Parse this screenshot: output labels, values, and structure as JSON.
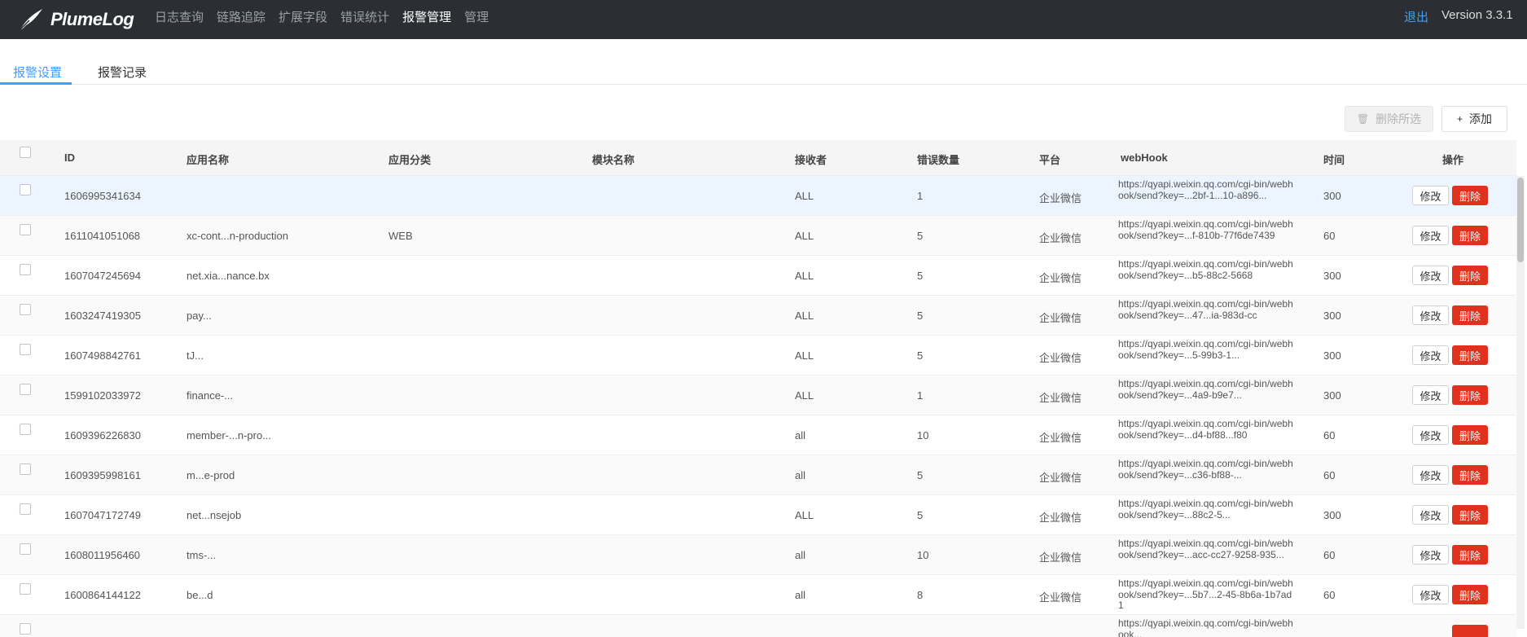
{
  "brand": {
    "name": "PlumeLog"
  },
  "nav": [
    {
      "label": "日志查询",
      "active": false
    },
    {
      "label": "链路追踪",
      "active": false
    },
    {
      "label": "扩展字段",
      "active": false
    },
    {
      "label": "错误统计",
      "active": false
    },
    {
      "label": "报警管理",
      "active": true
    },
    {
      "label": "管理",
      "active": false
    }
  ],
  "header": {
    "logout": "退出",
    "version": "Version 3.3.1"
  },
  "tabs": [
    {
      "label": "报警设置",
      "active": true
    },
    {
      "label": "报警记录",
      "active": false
    }
  ],
  "toolbar": {
    "delete_selected": "删除所选",
    "add": "添加"
  },
  "table": {
    "columns": [
      "ID",
      "应用名称",
      "应用分类",
      "模块名称",
      "接收者",
      "错误数量",
      "平台",
      "webHook",
      "时间",
      "操作"
    ],
    "actions": {
      "edit": "修改",
      "delete": "删除"
    },
    "rows": [
      {
        "id": "1606995341634",
        "app": "",
        "category": "",
        "module": "",
        "receiver": "ALL",
        "errors": "1",
        "platform": "企业微信",
        "webhook": "https://qyapi.weixin.qq.com/cgi-bin/webhook/send?key=...2bf-1...10-a896...",
        "time": "300"
      },
      {
        "id": "1611041051068",
        "app": "xc-cont...n-production",
        "category": "WEB",
        "module": "",
        "receiver": "ALL",
        "errors": "5",
        "platform": "企业微信",
        "webhook": "https://qyapi.weixin.qq.com/cgi-bin/webhook/send?key=...f-810b-77f6de7439",
        "time": "60"
      },
      {
        "id": "1607047245694",
        "app": "net.xia...nance.bx",
        "category": "",
        "module": "",
        "receiver": "ALL",
        "errors": "5",
        "platform": "企业微信",
        "webhook": "https://qyapi.weixin.qq.com/cgi-bin/webhook/send?key=...b5-88c2-5668",
        "time": "300"
      },
      {
        "id": "1603247419305",
        "app": "pay...",
        "category": "",
        "module": "",
        "receiver": "ALL",
        "errors": "5",
        "platform": "企业微信",
        "webhook": "https://qyapi.weixin.qq.com/cgi-bin/webhook/send?key=...47...ia-983d-cc",
        "time": "300"
      },
      {
        "id": "1607498842761",
        "app": "tJ...",
        "category": "",
        "module": "",
        "receiver": "ALL",
        "errors": "5",
        "platform": "企业微信",
        "webhook": "https://qyapi.weixin.qq.com/cgi-bin/webhook/send?key=...5-99b3-1...",
        "time": "300"
      },
      {
        "id": "1599102033972",
        "app": "finance-...",
        "category": "",
        "module": "",
        "receiver": "ALL",
        "errors": "1",
        "platform": "企业微信",
        "webhook": "https://qyapi.weixin.qq.com/cgi-bin/webhook/send?key=...4a9-b9e7...",
        "time": "300"
      },
      {
        "id": "1609396226830",
        "app": "member-...n-pro...",
        "category": "",
        "module": "",
        "receiver": "all",
        "errors": "10",
        "platform": "企业微信",
        "webhook": "https://qyapi.weixin.qq.com/cgi-bin/webhook/send?key=...d4-bf88...f80",
        "time": "60"
      },
      {
        "id": "1609395998161",
        "app": "m...e-prod",
        "category": "",
        "module": "",
        "receiver": "all",
        "errors": "5",
        "platform": "企业微信",
        "webhook": "https://qyapi.weixin.qq.com/cgi-bin/webhook/send?key=...c36-bf88-...",
        "time": "60"
      },
      {
        "id": "1607047172749",
        "app": "net...nsejob",
        "category": "",
        "module": "",
        "receiver": "ALL",
        "errors": "5",
        "platform": "企业微信",
        "webhook": "https://qyapi.weixin.qq.com/cgi-bin/webhook/send?key=...88c2-5...",
        "time": "300"
      },
      {
        "id": "1608011956460",
        "app": "tms-...",
        "category": "",
        "module": "",
        "receiver": "all",
        "errors": "10",
        "platform": "企业微信",
        "webhook": "https://qyapi.weixin.qq.com/cgi-bin/webhook/send?key=...acc-cc27-9258-935...",
        "time": "60"
      },
      {
        "id": "1600864144122",
        "app": "be...d",
        "category": "",
        "module": "",
        "receiver": "all",
        "errors": "8",
        "platform": "企业微信",
        "webhook": "https://qyapi.weixin.qq.com/cgi-bin/webhook/send?key=...5b7...2-45-8b6a-1b7ad1",
        "time": "60"
      },
      {
        "id": "",
        "app": "",
        "category": "",
        "module": "",
        "receiver": "",
        "errors": "",
        "platform": "",
        "webhook": "https://qyapi.weixin.qq.com/cgi-bin/webhook...",
        "time": ""
      }
    ]
  }
}
